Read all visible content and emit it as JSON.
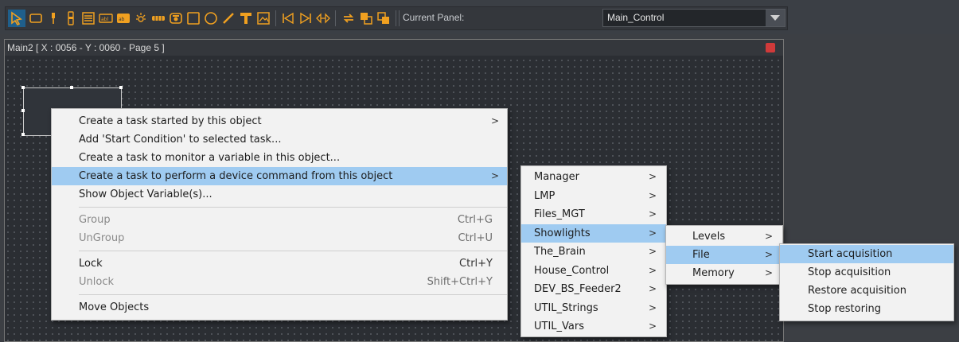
{
  "toolbar": {
    "icons": [
      "pointer-icon",
      "rectangle-icon",
      "pin-icon",
      "slider-icon",
      "list-icon",
      "textbox-icon",
      "label-icon",
      "light-icon",
      "led-bar-icon",
      "camera-icon",
      "square-icon",
      "circle-icon",
      "line-icon",
      "text-icon",
      "image-icon",
      "first-icon",
      "last-icon",
      "arrow-h-icon",
      "swap-icon",
      "bring-front-icon",
      "send-back-icon"
    ],
    "current_panel_label": "Current Panel:",
    "current_panel_value": "Main_Control"
  },
  "panel": {
    "title": "Main2 [ X : 0056 - Y : 0060 - Page 5 ]"
  },
  "context_menu": {
    "items": [
      {
        "label": "Create a  task started by this object",
        "has_submenu": true
      },
      {
        "label": "Add 'Start Condition' to selected task..."
      },
      {
        "label": "Create a task to monitor a variable in this object..."
      },
      {
        "label": "Create a task to perform a device command from this object",
        "has_submenu": true,
        "highlighted": true
      },
      {
        "label": "Show Object Variable(s)..."
      },
      {
        "label": "Group",
        "shortcut": "Ctrl+G",
        "disabled": true
      },
      {
        "label": "UnGroup",
        "shortcut": "Ctrl+U",
        "disabled": true
      },
      {
        "label": "Lock",
        "shortcut": "Ctrl+Y"
      },
      {
        "label": "Unlock",
        "shortcut": "Shift+Ctrl+Y",
        "disabled": true
      },
      {
        "label": "Move Objects"
      }
    ]
  },
  "device_menu": {
    "items": [
      "Manager",
      "LMP",
      "Files_MGT",
      "Showlights",
      "The_Brain",
      "House_Control",
      "DEV_BS_Feeder2",
      "UTIL_Strings",
      "UTIL_Vars"
    ],
    "highlighted": "Showlights"
  },
  "showlights_menu": {
    "items": [
      "Levels",
      "File",
      "Memory"
    ],
    "highlighted": "File"
  },
  "file_menu": {
    "items": [
      "Start acquisition",
      "Stop acquisition",
      "Restore acquisition",
      "Stop restoring"
    ],
    "highlighted": "Start acquisition"
  },
  "arrow_glyph": ">",
  "colors": {
    "highlight": "#9fcbf1",
    "menu_bg": "#f2f2f2",
    "toolbar_icon": "#f0a020",
    "toolbar_active": "#1f5f8b",
    "close_button": "#d03a3a"
  }
}
